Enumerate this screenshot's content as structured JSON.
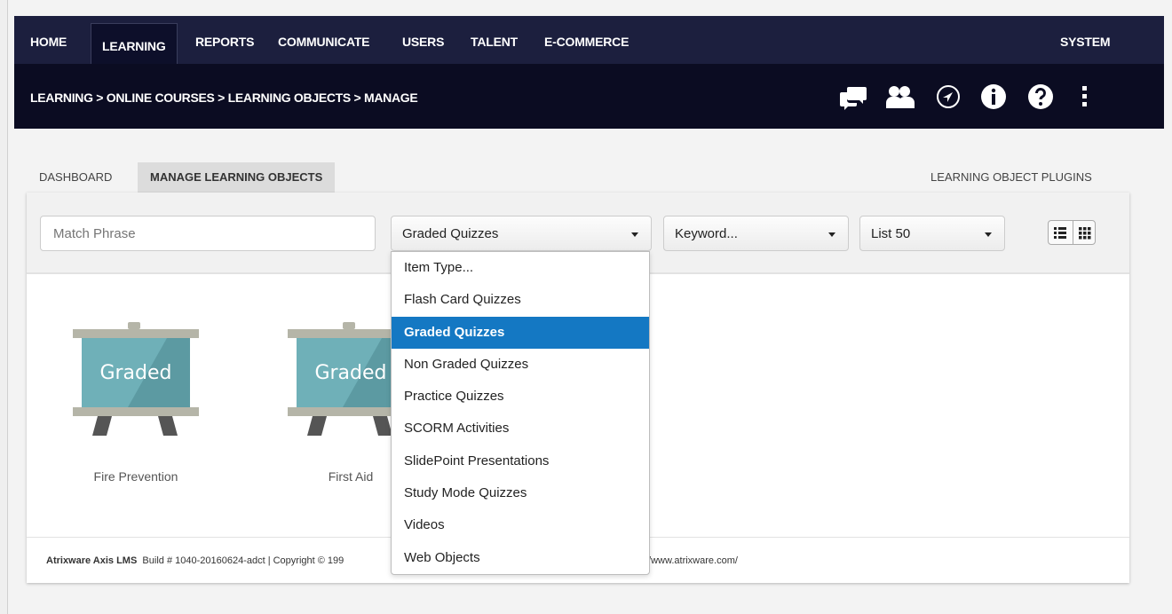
{
  "nav": {
    "items": [
      "HOME",
      "LEARNING",
      "REPORTS",
      "COMMUNICATE",
      "USERS",
      "TALENT",
      "E-COMMERCE"
    ],
    "active": "LEARNING",
    "system": "SYSTEM"
  },
  "breadcrumb": "LEARNING > ONLINE COURSES > LEARNING OBJECTS > MANAGE",
  "header_icons": [
    "chat-icon",
    "users-icon",
    "navigation-icon",
    "info-icon",
    "help-icon",
    "more-vertical-icon"
  ],
  "tabs": {
    "dashboard": "DASHBOARD",
    "manage": "MANAGE LEARNING OBJECTS",
    "plugins": "LEARNING OBJECT PLUGINS"
  },
  "filters": {
    "search_placeholder": "Match Phrase",
    "item_type": "Graded Quizzes",
    "keyword": "Keyword...",
    "list": "List 50"
  },
  "dropdown": {
    "options": [
      "Item Type...",
      "Flash Card Quizzes",
      "Graded Quizzes",
      "Non Graded Quizzes",
      "Practice Quizzes",
      "SCORM Activities",
      "SlidePoint Presentations",
      "Study Mode Quizzes",
      "Videos",
      "Web Objects"
    ],
    "selected": "Graded Quizzes"
  },
  "tiles": [
    {
      "board_text": "Graded",
      "label": "Fire Prevention"
    },
    {
      "board_text": "Graded",
      "label": "First Aid"
    }
  ],
  "footer": {
    "brand": "Atrixware Axis LMS",
    "build": "Build # 1040-20160624-adct | Copyright © 199",
    "url_tail": "//www.atrixware.com/"
  },
  "colors": {
    "nav_bg": "#1c1f3e",
    "subbar_bg": "#0b0c22",
    "selected_option": "#1478c3",
    "board": "#6fb0b8"
  }
}
